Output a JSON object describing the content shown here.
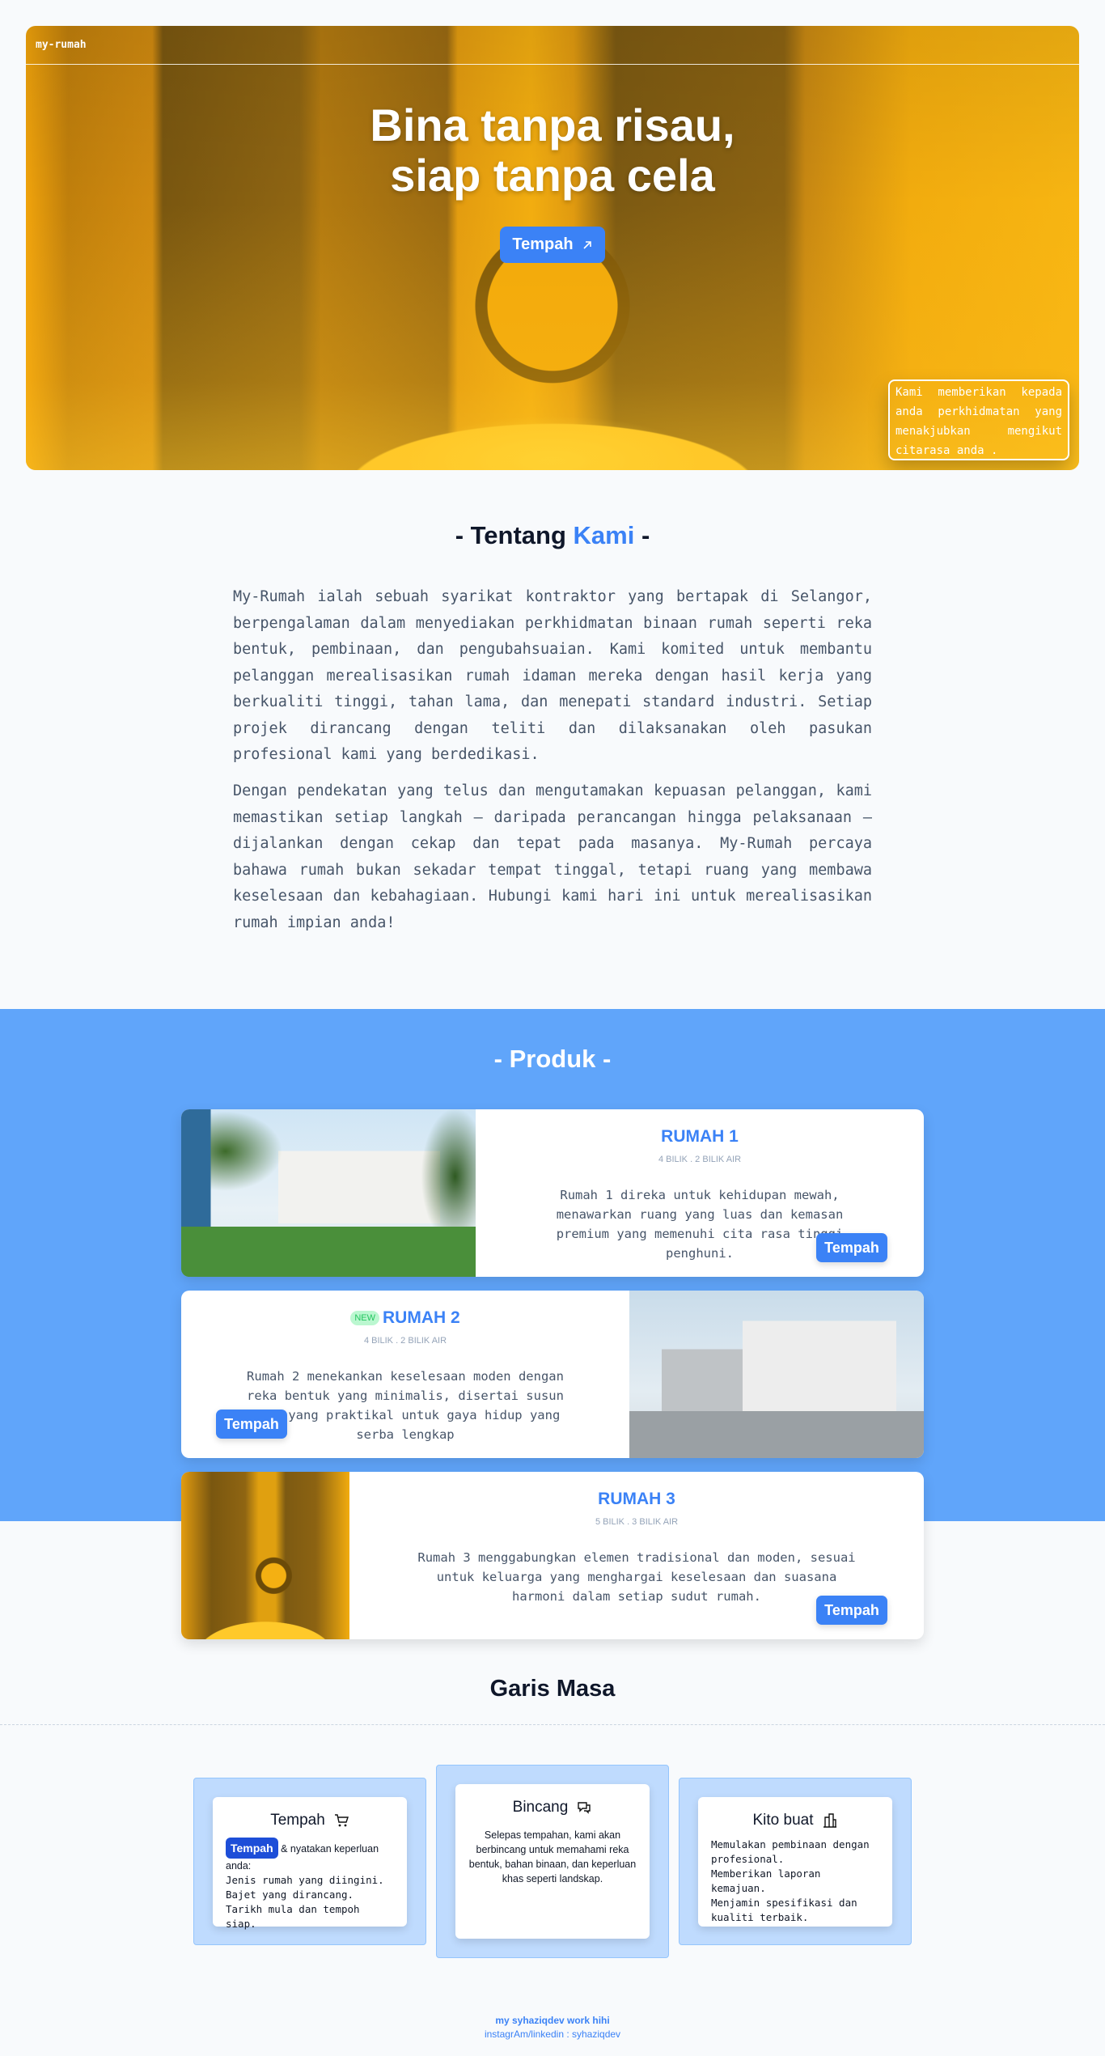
{
  "hero": {
    "brand": "my-rumah",
    "title_line1": "Bina tanpa risau,",
    "title_line2": "siap tanpa cela",
    "button_label": "Tempah",
    "button_icon": "arrow-up-right-icon",
    "note": "Kami memberikan kepada anda perkhidmatan yang menakjubkan mengikut citarasa anda ."
  },
  "about": {
    "title_prefix": "- Tentang ",
    "title_accent": "Kami",
    "title_suffix": " -",
    "paragraph1": "My-Rumah ialah sebuah syarikat kontraktor yang bertapak di Selangor, berpengalaman dalam menyediakan perkhidmatan binaan rumah seperti reka bentuk, pembinaan, dan pengubahsuaian. Kami komited untuk membantu pelanggan merealisasikan rumah idaman mereka dengan hasil kerja yang berkualiti tinggi, tahan lama, dan menepati standard industri. Setiap projek dirancang dengan teliti dan dilaksanakan oleh pasukan profesional kami yang berdedikasi.",
    "paragraph2": "Dengan pendekatan yang telus dan mengutamakan kepuasan pelanggan, kami memastikan setiap langkah – daripada perancangan hingga pelaksanaan – dijalankan dengan cekap dan tepat pada masanya. My-Rumah percaya bahawa rumah bukan sekadar tempat tinggal, tetapi ruang yang membawa keselesaan dan kebahagiaan. Hubungi kami hari ini untuk merealisasikan rumah impian anda!"
  },
  "products": {
    "title": "- Produk -",
    "items": [
      {
        "name": "RUMAH 1",
        "meta": "4 BILIK . 2 BILIK AIR",
        "description": "Rumah 1 direka untuk kehidupan mewah, menawarkan ruang yang luas dan kemasan premium yang memenuhi cita rasa tinggi penghuni.",
        "button": "Tempah"
      },
      {
        "badge": "NEW",
        "name": "RUMAH 2",
        "meta": "4 BILIK . 2 BILIK AIR",
        "description": "Rumah 2 menekankan keselesaan moden dengan reka bentuk yang minimalis, disertai susun atur yang praktikal untuk gaya hidup yang serba lengkap",
        "button": "Tempah"
      },
      {
        "name": "RUMAH 3",
        "meta": "5 BILIK . 3 BILIK AIR",
        "description": "Rumah 3 menggabungkan elemen tradisional dan moden, sesuai untuk keluarga yang menghargai keselesaan dan suasana harmoni dalam setiap sudut rumah.",
        "button": "Tempah"
      }
    ]
  },
  "timeline": {
    "title": "Garis Masa",
    "steps": [
      {
        "title": "Tempah",
        "icon": "cart-icon",
        "badge": "Tempah",
        "lead": " & nyatakan keperluan anda:",
        "lines": [
          "Jenis rumah yang diingini.",
          "Bajet yang dirancang.",
          "Tarikh mula dan tempoh siap."
        ]
      },
      {
        "title": "Bincang",
        "icon": "chat-icon",
        "text": "Selepas tempahan, kami akan berbincang untuk memahami reka bentuk, bahan binaan, dan keperluan khas seperti landskap."
      },
      {
        "title": "Kito buat",
        "icon": "building-icon",
        "lines": [
          "Memulakan pembinaan dengan profesional.",
          "Memberikan laporan kemajuan.",
          "Menjamin spesifikasi dan kualiti terbaik."
        ]
      }
    ]
  },
  "footer": {
    "line1": "my syhaziqdev work hihi",
    "line2": "instagrAm/linkedin : syhaziqdev"
  },
  "colors": {
    "accent": "#3b82f6",
    "product_band": "#60a5fa",
    "hero_gold": "#f2ac0e"
  }
}
